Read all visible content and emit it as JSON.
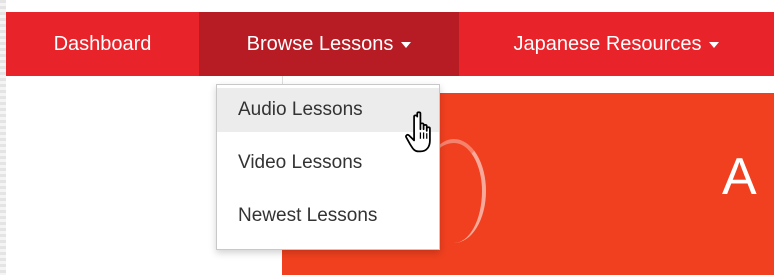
{
  "nav": {
    "items": [
      {
        "label": "Dashboard",
        "has_caret": false,
        "active": false
      },
      {
        "label": "Browse Lessons",
        "has_caret": true,
        "active": true
      },
      {
        "label": "Japanese Resources",
        "has_caret": true,
        "active": false
      }
    ],
    "bar_color": "#e8232a",
    "active_color": "#b71c24"
  },
  "dropdown": {
    "items": [
      {
        "label": "Audio Lessons",
        "hovered": true
      },
      {
        "label": "Video Lessons",
        "hovered": false
      },
      {
        "label": "Newest Lessons",
        "hovered": false
      }
    ]
  },
  "hero": {
    "visible_text": "A",
    "background": "#f0401f"
  },
  "cursor": {
    "icon": "hand-pointer-icon"
  }
}
